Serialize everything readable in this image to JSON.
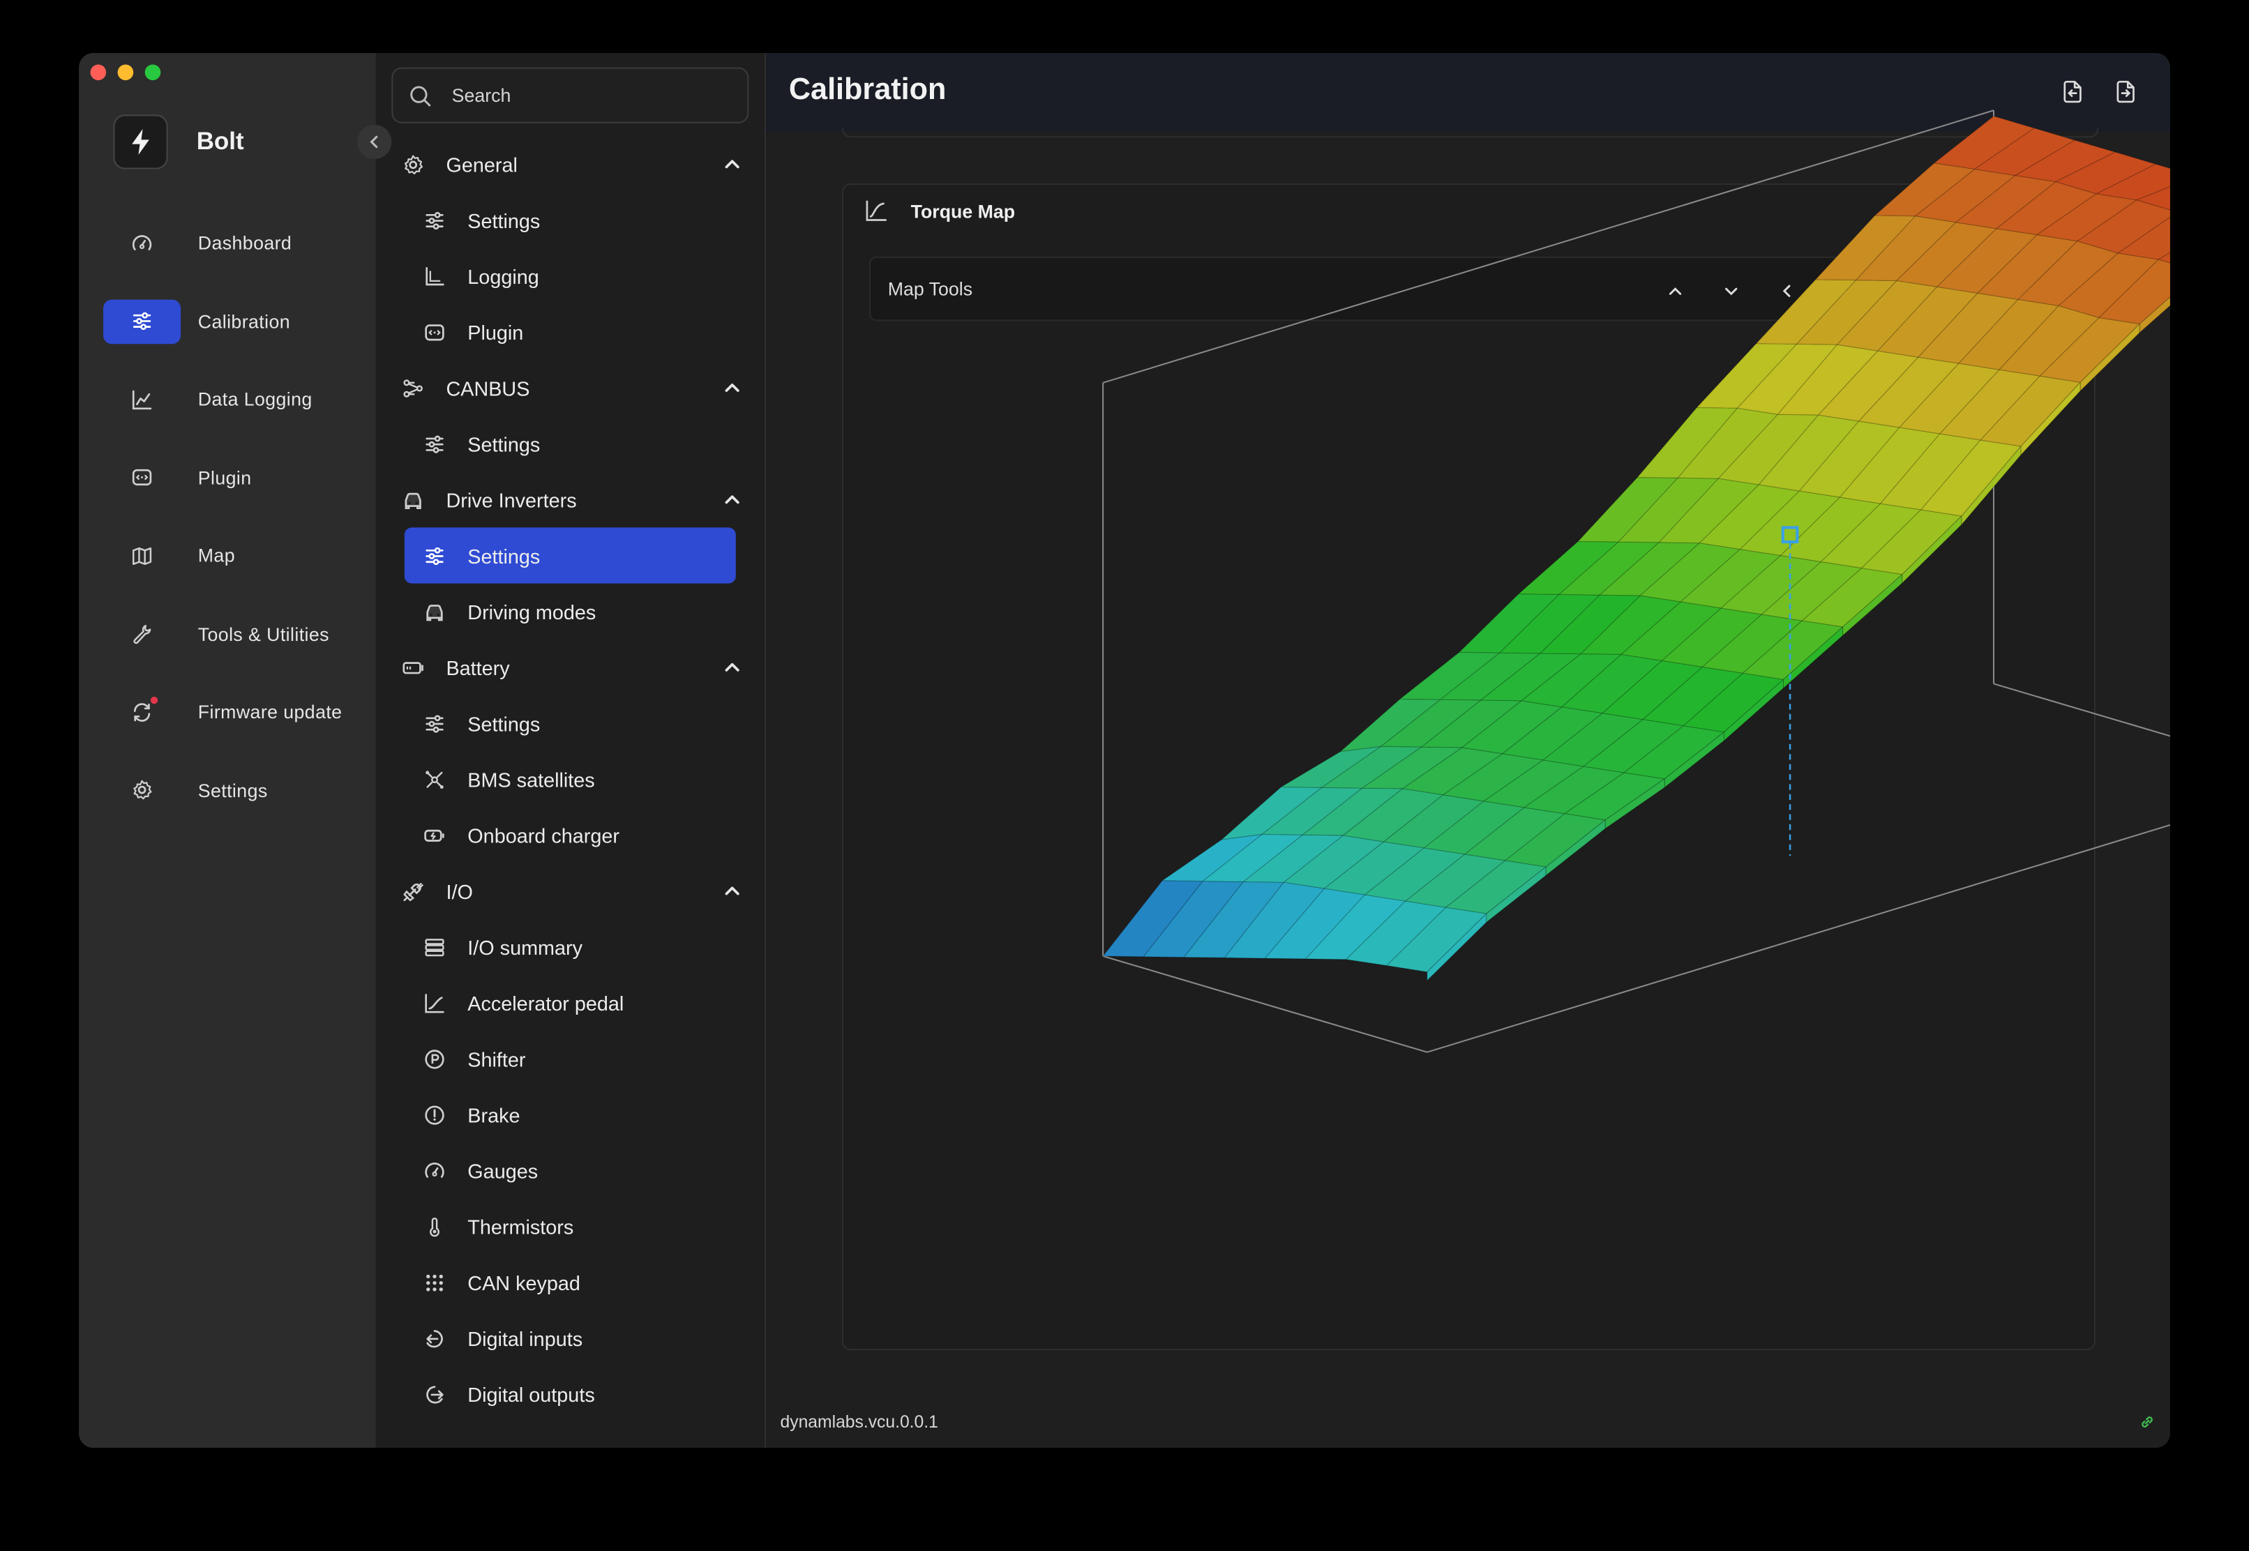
{
  "app": {
    "name": "Bolt",
    "page_title": "Calibration",
    "version": "dynamlabs.vcu.0.0.1"
  },
  "colors": {
    "accent": "#2f4bd3",
    "notification": "#e4374a",
    "connected": "#3fb950"
  },
  "rail": [
    {
      "label": "Dashboard",
      "icon": "gauge-icon"
    },
    {
      "label": "Calibration",
      "icon": "sliders-icon",
      "active": true
    },
    {
      "label": "Data Logging",
      "icon": "chart-line-icon"
    },
    {
      "label": "Plugin",
      "icon": "plugin-icon"
    },
    {
      "label": "Map",
      "icon": "map-icon"
    },
    {
      "label": "Tools & Utilities",
      "icon": "wrench-icon"
    },
    {
      "label": "Firmware update",
      "icon": "refresh-icon",
      "badge": true
    },
    {
      "label": "Settings",
      "icon": "gear-icon"
    }
  ],
  "search": {
    "placeholder": "Search"
  },
  "tree": [
    {
      "label": "General",
      "icon": "gear-icon",
      "items": [
        {
          "label": "Settings",
          "icon": "sliders-icon"
        },
        {
          "label": "Logging",
          "icon": "logging-icon"
        },
        {
          "label": "Plugin",
          "icon": "plugin-icon"
        }
      ]
    },
    {
      "label": "CANBUS",
      "icon": "network-icon",
      "items": [
        {
          "label": "Settings",
          "icon": "sliders-icon"
        }
      ]
    },
    {
      "label": "Drive Inverters",
      "icon": "car-icon",
      "items": [
        {
          "label": "Settings",
          "icon": "sliders-icon",
          "active": true
        },
        {
          "label": "Driving modes",
          "icon": "car-icon"
        }
      ]
    },
    {
      "label": "Battery",
      "icon": "battery-icon",
      "items": [
        {
          "label": "Settings",
          "icon": "sliders-icon"
        },
        {
          "label": "BMS satellites",
          "icon": "satellite-icon"
        },
        {
          "label": "Onboard charger",
          "icon": "charger-icon"
        }
      ]
    },
    {
      "label": "I/O",
      "icon": "plug-icon",
      "items": [
        {
          "label": "I/O summary",
          "icon": "list-icon"
        },
        {
          "label": "Accelerator pedal",
          "icon": "curve-icon"
        },
        {
          "label": "Shifter",
          "icon": "parking-icon"
        },
        {
          "label": "Brake",
          "icon": "brake-icon"
        },
        {
          "label": "Gauges",
          "icon": "gauge-icon"
        },
        {
          "label": "Thermistors",
          "icon": "thermometer-icon"
        },
        {
          "label": "CAN keypad",
          "icon": "keypad-icon"
        },
        {
          "label": "Digital inputs",
          "icon": "input-icon"
        },
        {
          "label": "Digital outputs",
          "icon": "output-icon"
        }
      ]
    }
  ],
  "card": {
    "title": "Torque Map",
    "tools_label": "Map Tools",
    "tool_buttons": [
      "chevron-up-icon",
      "chevron-down-icon",
      "chevron-left-icon",
      "chevron-right-icon",
      "zoom-in-icon",
      "zoom-out-icon",
      "table-icon"
    ]
  },
  "chart_data": {
    "type": "surface",
    "rows": 9,
    "cols": 16,
    "colormap": [
      "#1f5fbf",
      "#2ab9c8",
      "#2db44a",
      "#22b52a",
      "#8fc21f",
      "#c4c024",
      "#c98a21",
      "#c9421d"
    ],
    "z": [
      [
        0.0,
        0.1,
        0.14,
        0.2,
        0.23,
        0.29,
        0.34,
        0.41,
        0.47,
        0.55,
        0.64,
        0.72,
        0.8,
        0.88,
        0.94,
        0.99
      ],
      [
        0.02,
        0.12,
        0.17,
        0.22,
        0.26,
        0.31,
        0.36,
        0.43,
        0.49,
        0.57,
        0.66,
        0.74,
        0.82,
        0.9,
        0.95,
        0.99
      ],
      [
        0.04,
        0.14,
        0.19,
        0.24,
        0.28,
        0.33,
        0.38,
        0.45,
        0.51,
        0.59,
        0.67,
        0.76,
        0.84,
        0.91,
        0.96,
        0.99
      ],
      [
        0.06,
        0.16,
        0.21,
        0.26,
        0.3,
        0.35,
        0.4,
        0.47,
        0.53,
        0.6,
        0.69,
        0.77,
        0.85,
        0.92,
        0.97,
        0.99
      ],
      [
        0.08,
        0.17,
        0.22,
        0.27,
        0.31,
        0.36,
        0.42,
        0.48,
        0.54,
        0.61,
        0.7,
        0.78,
        0.86,
        0.93,
        0.97,
        0.99
      ],
      [
        0.1,
        0.18,
        0.23,
        0.28,
        0.32,
        0.37,
        0.43,
        0.49,
        0.55,
        0.62,
        0.71,
        0.79,
        0.87,
        0.94,
        0.98,
        0.99
      ],
      [
        0.12,
        0.19,
        0.24,
        0.29,
        0.33,
        0.38,
        0.44,
        0.5,
        0.56,
        0.63,
        0.72,
        0.8,
        0.88,
        0.94,
        0.98,
        0.99
      ],
      [
        0.13,
        0.2,
        0.25,
        0.3,
        0.34,
        0.39,
        0.45,
        0.51,
        0.57,
        0.64,
        0.73,
        0.81,
        0.88,
        0.95,
        0.98,
        0.99
      ],
      [
        0.14,
        0.21,
        0.26,
        0.31,
        0.35,
        0.4,
        0.46,
        0.52,
        0.58,
        0.65,
        0.74,
        0.82,
        0.89,
        0.95,
        0.99,
        0.99
      ]
    ]
  }
}
